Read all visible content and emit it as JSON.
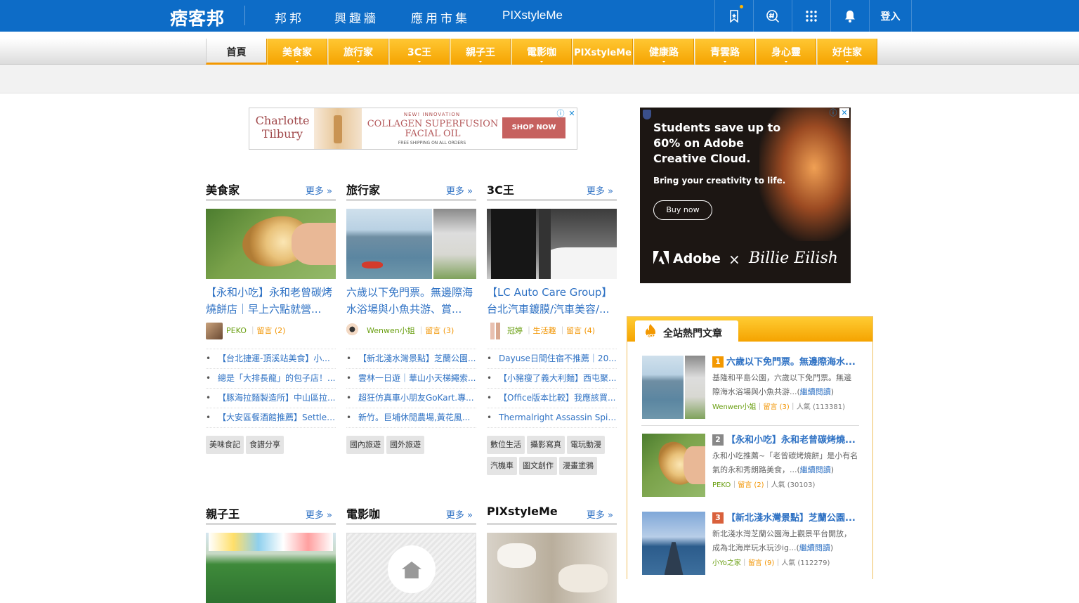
{
  "topbar": {
    "logo": "痞客邦",
    "nav": [
      "邦邦",
      "興趣牆",
      "應用市集",
      "PIXstyleMe"
    ],
    "icons": [
      "bookmark-icon",
      "hashtag-search-icon",
      "apps-grid-icon",
      "bell-icon"
    ],
    "login": "登入"
  },
  "categories": [
    "首頁",
    "美食家",
    "旅行家",
    "3C王",
    "親子王",
    "電影咖",
    "PIXstyleMe",
    "健康路",
    "青雲路",
    "身心靈",
    "好住家"
  ],
  "ad_top": {
    "brand": "Charlotte Tilbury",
    "kicker": "NEW! INNOVATION",
    "line1": "COLLAGEN SUPERFUSION",
    "line2": "FACIAL OIL",
    "shipping": "FREE SHIPPING ON ALL ORDERS",
    "cta": "SHOP NOW"
  },
  "ad_side": {
    "headline": "Students save up to 60% on Adobe Creative Cloud.",
    "sub": "Bring your creativity to life.",
    "cta": "Buy now",
    "brand": "Adobe",
    "times": "×",
    "partner": "Billie Eilish"
  },
  "more_label": "更多 »",
  "sections": [
    {
      "title": "美食家",
      "headline": "【永和小吃】永和老曾碳烤燒餅店｜早上六點就營...",
      "author": "PEKO",
      "channel": "",
      "comments": "留言 (2)",
      "list": [
        "【台北捷運-頂溪站美食】小...",
        "總是「大排長龍」的包子店！...",
        "【豚海拉麵製造所】中山區拉...",
        "【大安區餐酒館推薦】Settle ..."
      ],
      "tags": [
        "美味食記",
        "食譜分享"
      ]
    },
    {
      "title": "旅行家",
      "headline": "六歲以下免門票。無邊際海水浴場與小魚共游、賞...",
      "author": "Wenwen小姐",
      "channel": "",
      "comments": "留言 (3)",
      "list": [
        "【新北淺水灣景點】芝蘭公園...",
        "雲林一日遊｜華山小天梯繩索...",
        "超狂仿真車小朋友GoKart.專...",
        "新竹。巨埔休閒農場,黃花風..."
      ],
      "tags": [
        "國內旅遊",
        "國外旅遊"
      ]
    },
    {
      "title": "3C王",
      "headline": "【LC Auto Care Group】台北汽車鍍膜/汽車美容/...",
      "author": "冠婷",
      "channel": "生活趣",
      "comments": "留言 (4)",
      "list": [
        "Dayuse日間住宿不推薦｜20...",
        "【小豬瘦了義大利麵】西屯聚...",
        "【Office版本比較】我應該買...",
        "Thermalright Assassin Spirit ..."
      ],
      "tags": [
        "數位生活",
        "攝影寫真",
        "電玩動漫",
        "汽機車",
        "圖文創作",
        "漫畫塗鴉"
      ]
    },
    {
      "title": "親子王"
    },
    {
      "title": "電影咖"
    },
    {
      "title": "PIXstyleMe"
    }
  ],
  "hot": {
    "title": "全站熱門文章",
    "read_more": "繼續閱讀",
    "items": [
      {
        "rank": "1",
        "title": "六歲以下免門票。無邊際海水...",
        "summary": "基隆和平島公園，六歲以下免門票。無邊際海水浴場與小魚共游...",
        "author": "Wenwen小姐",
        "comments": "留言 (3)",
        "views": "人氣 (113381)",
        "color": "#f39800"
      },
      {
        "rank": "2",
        "title": "【永和小吃】永和老曾碳烤燒...",
        "summary": "永和小吃推薦~「老曾碳烤燒餅」是小有名氣的永和秀朗路美食，...",
        "author": "PEKO",
        "comments": "留言 (2)",
        "views": "人氣 (30103)",
        "color": "#888888"
      },
      {
        "rank": "3",
        "title": "【新北淺水灣景點】芝蘭公園...",
        "summary": "新北淺水灣芝蘭公園海上觀景平台開放，成為北海岸玩水玩沙ig...",
        "author": "小Yo之家",
        "comments": "留言 (9)",
        "views": "人氣 (112279)",
        "color": "#d9603b"
      }
    ]
  }
}
